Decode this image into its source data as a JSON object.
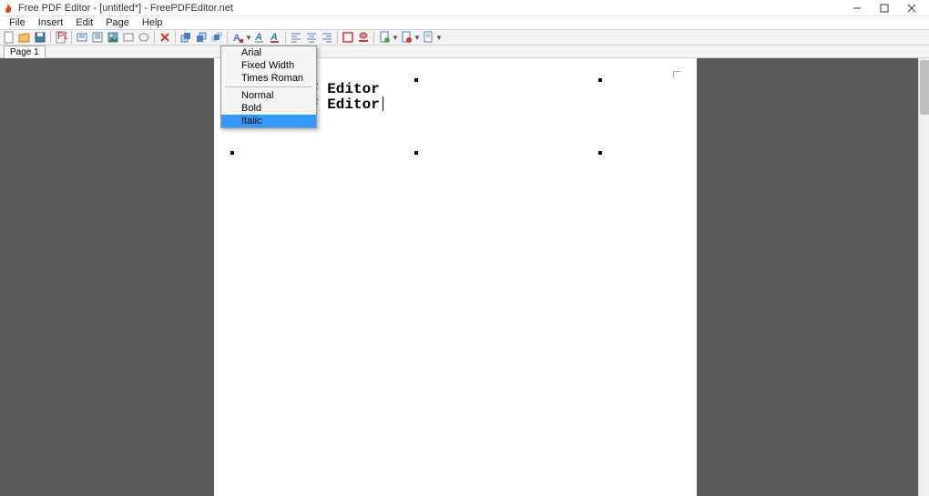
{
  "titlebar": {
    "title": "Free PDF Editor - [untitled*] - FreePDFEditor.net"
  },
  "menubar": {
    "items": [
      "File",
      "Insert",
      "Edit",
      "Page",
      "Help"
    ]
  },
  "pagebar": {
    "tab": "Page 1"
  },
  "dropdown": {
    "fonts": [
      "Arial",
      "Fixed Width",
      "Times Roman"
    ],
    "styles": [
      "Normal",
      "Bold",
      "Italic"
    ],
    "highlighted": "Italic"
  },
  "document": {
    "line1": "F Editor",
    "line2": "F Editor"
  }
}
